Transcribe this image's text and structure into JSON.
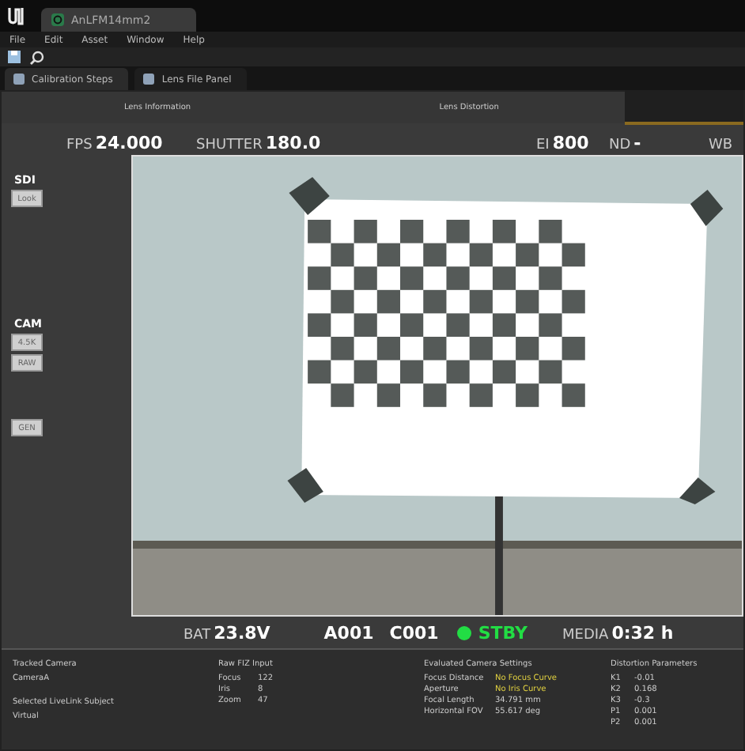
{
  "window": {
    "tab_title": "AnLFM14mm2"
  },
  "menu": [
    "File",
    "Edit",
    "Asset",
    "Window",
    "Help"
  ],
  "panel_tabs": [
    {
      "label": "Calibration Steps",
      "selected": true
    },
    {
      "label": "Lens File Panel",
      "selected": false
    }
  ],
  "sub_tabs": [
    {
      "label": "Lens Information",
      "selected": false
    },
    {
      "label": "Lens Distortion",
      "selected": false
    }
  ],
  "hud_top": [
    {
      "label": "FPS",
      "value": "24.000"
    },
    {
      "label": "SHUTTER",
      "value": "180.0"
    },
    {
      "label": "EI",
      "value": "800"
    },
    {
      "label": "ND",
      "value": "-"
    },
    {
      "label": "WB"
    }
  ],
  "side_groups": [
    {
      "title": "SDI",
      "buttons": [
        "Look"
      ]
    },
    {
      "title": "CAM",
      "buttons": [
        "4.5K",
        "RAW"
      ]
    },
    {
      "buttons": [
        "GEN"
      ]
    }
  ],
  "hud_bottom": {
    "battery_label": "BAT",
    "battery": "23.8V",
    "reel": "A001",
    "clip": "C001",
    "status": "STBY",
    "recording": false,
    "media_label": "MEDIA",
    "media": "0:32 h"
  },
  "info": {
    "tracked_camera_label": "Tracked Camera",
    "tracked_camera": "CameraA",
    "subject_label": "Selected LiveLink Subject",
    "subject": "Virtual",
    "fiz_title": "Raw FIZ Input",
    "fiz": [
      {
        "name": "Focus",
        "value": "122"
      },
      {
        "name": "Iris",
        "value": "8"
      },
      {
        "name": "Zoom",
        "value": "47"
      }
    ],
    "evaluated_title": "Evaluated Camera Settings",
    "evaluated": [
      {
        "name": "Focus Distance",
        "value": "No Focus Curve",
        "warning": true
      },
      {
        "name": "Aperture",
        "value": "No Iris Curve",
        "warning": true
      },
      {
        "name": "Focal Length",
        "value": "34.791 mm",
        "warning": false
      },
      {
        "name": "Horizontal FOV",
        "value": "55.617 deg",
        "warning": false
      }
    ],
    "distortion_title": "Distortion Parameters",
    "distortion": [
      {
        "name": "K1",
        "value": "-0.01"
      },
      {
        "name": "K2",
        "value": "0.168"
      },
      {
        "name": "K3",
        "value": "-0.3"
      },
      {
        "name": "P1",
        "value": "0.001"
      },
      {
        "name": "P2",
        "value": "0.001"
      }
    ]
  }
}
